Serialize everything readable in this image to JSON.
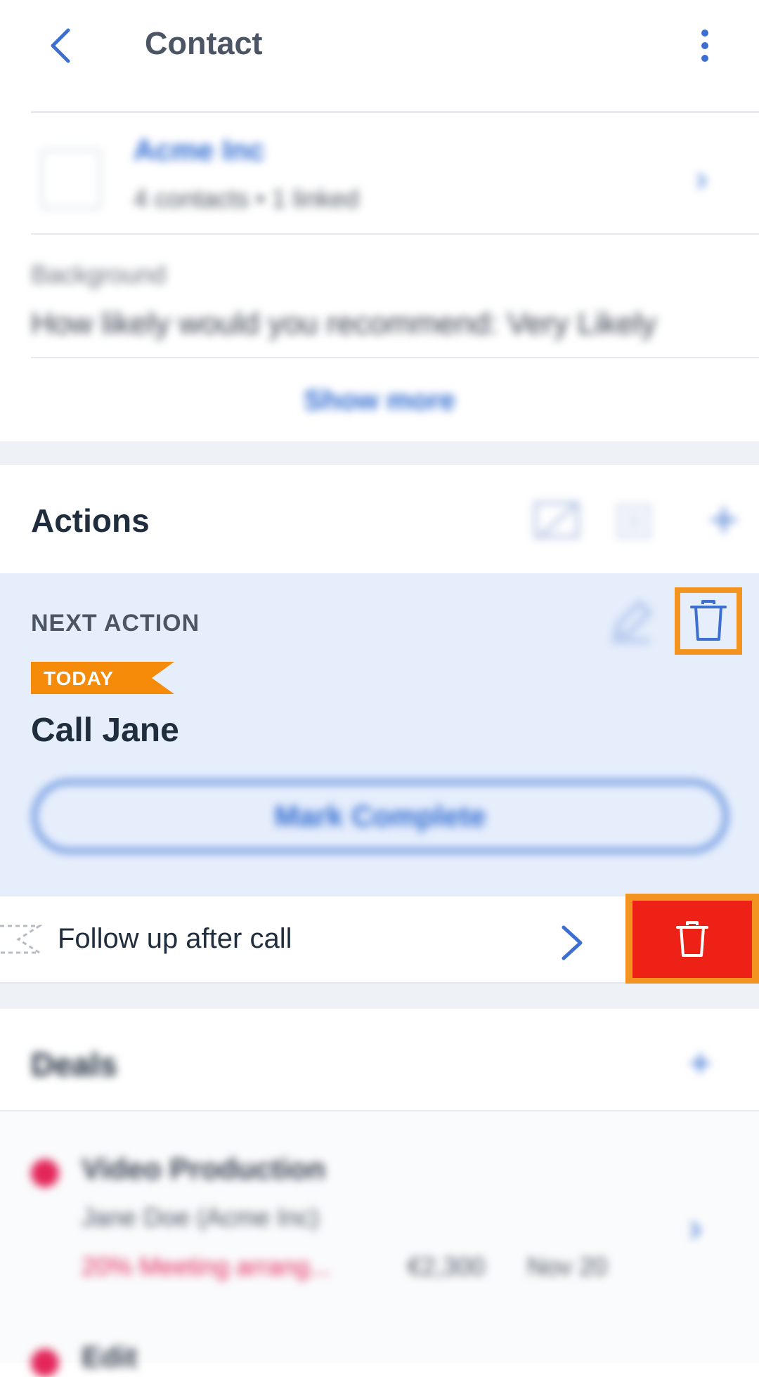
{
  "header": {
    "title": "Contact"
  },
  "company": {
    "name": "Acme Inc",
    "subtitle": "4 contacts • 1 linked"
  },
  "background": {
    "label": "Background",
    "value": "How likely would you recommend: Very Likely"
  },
  "show_more": "Show more",
  "actions": {
    "title": "Actions",
    "next_label": "NEXT ACTION",
    "tag": "TODAY",
    "task_title": "Call Jane",
    "mark_complete": "Mark Complete",
    "row_text": "Follow up after call"
  },
  "deals": {
    "title": "Deals",
    "items": [
      {
        "name": "Video Production",
        "contact": "Jane Doe (Acme Inc)",
        "stage": "20% Meeting arrang...",
        "amount": "€2,300",
        "date": "Nov 20"
      },
      {
        "name": "Edit"
      }
    ]
  },
  "colors": {
    "accent": "#2e6ad1",
    "highlight": "#f39420",
    "danger": "#ee2117",
    "panel": "#e6eefc",
    "tag": "#f68a09"
  }
}
